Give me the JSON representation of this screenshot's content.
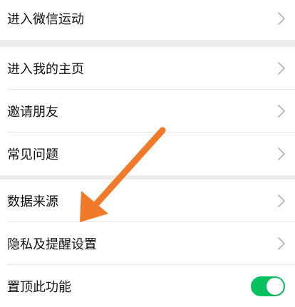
{
  "sections": [
    {
      "items": [
        {
          "label": "进入微信运动",
          "control": "chevron"
        }
      ]
    },
    {
      "items": [
        {
          "label": "进入我的主页",
          "control": "chevron"
        },
        {
          "label": "邀请朋友",
          "control": "chevron"
        },
        {
          "label": "常见问题",
          "control": "chevron"
        }
      ]
    },
    {
      "items": [
        {
          "label": "数据来源",
          "control": "chevron"
        },
        {
          "label": "隐私及提醒设置",
          "control": "chevron"
        },
        {
          "label": "置顶此功能",
          "control": "toggle",
          "toggle_on": true
        }
      ]
    }
  ],
  "icons": {
    "chevron": "chevron-right-icon",
    "annotation": "orange-arrow-icon"
  },
  "colors": {
    "background": "#ededed",
    "row": "#ffffff",
    "text": "#111111",
    "chevron": "#b2b2b2",
    "divider": "#e5e5e5",
    "toggle_on": "#07c160",
    "annotation_arrow": "#f07a2a"
  }
}
